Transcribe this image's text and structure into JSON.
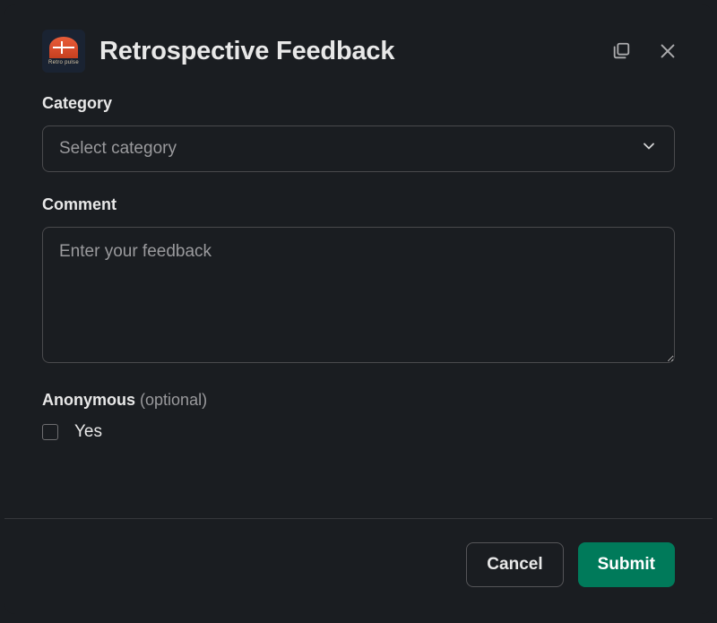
{
  "header": {
    "app_name": "Retro pulse",
    "title": "Retrospective Feedback"
  },
  "form": {
    "category": {
      "label": "Category",
      "placeholder": "Select category"
    },
    "comment": {
      "label": "Comment",
      "placeholder": "Enter your feedback"
    },
    "anonymous": {
      "label": "Anonymous",
      "optional": "(optional)",
      "option_label": "Yes"
    }
  },
  "footer": {
    "cancel": "Cancel",
    "submit": "Submit"
  }
}
